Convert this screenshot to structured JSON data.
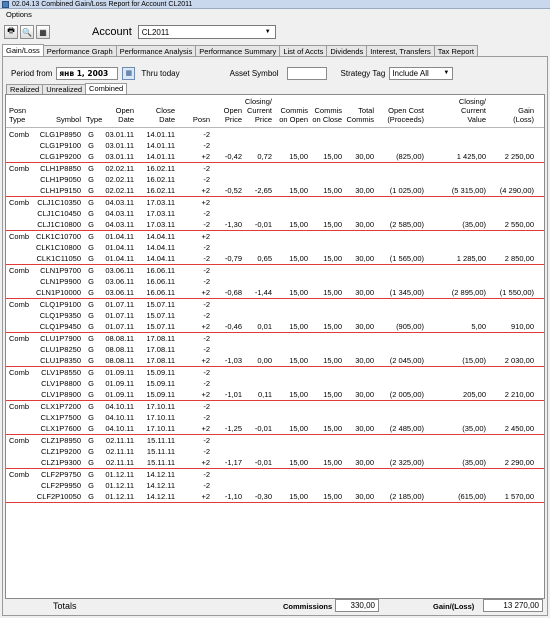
{
  "window": {
    "title": "02.04.13  Combined Gain/Loss Report for Account  CL2011"
  },
  "menu": {
    "options": "Options"
  },
  "toolbar": {
    "icons": [
      "printer-icon",
      "print-preview-icon",
      "export-icon"
    ],
    "account_label": "Account",
    "account_value": "CL2011"
  },
  "main_tabs": [
    "Gain/Loss",
    "Performance Graph",
    "Performance Analysis",
    "Performance Summary",
    "List of Accts",
    "Dividends",
    "Interest, Transfers",
    "Tax Report"
  ],
  "filters": {
    "period_from_label": "Period from",
    "period_from_value": "янв 1, 2003",
    "thru_label": "Thru  today",
    "asset_symbol_label": "Asset Symbol",
    "asset_symbol_value": "",
    "strategy_tag_label": "Strategy Tag",
    "strategy_tag_value": "Include All"
  },
  "sub_tabs": [
    "Realized",
    "Unrealized",
    "Combined"
  ],
  "columns": {
    "posn_type": [
      "Posn",
      "Type"
    ],
    "symbol": [
      "",
      "Symbol"
    ],
    "type": [
      "",
      "Type"
    ],
    "open_date": [
      "Open",
      "Date"
    ],
    "close_date": [
      "Close",
      "Date"
    ],
    "posn": [
      "",
      "Posn"
    ],
    "open_price": [
      "Open",
      "Price"
    ],
    "closing_price": [
      "Closing/",
      "Current",
      "Price"
    ],
    "commis_open": [
      "Commis",
      "on Open"
    ],
    "commis_close": [
      "Commis",
      "on Close"
    ],
    "total_commis": [
      "Total",
      "Commis"
    ],
    "open_cost": [
      "Open Cost",
      "(Proceeds)"
    ],
    "closing_value": [
      "Closing/",
      "Current",
      "Value"
    ],
    "gain": [
      "Gain",
      "(Loss)"
    ]
  },
  "groups": [
    {
      "rows": [
        [
          "Comb",
          "CLG1P8950",
          "G",
          "03.01.11",
          "14.01.11",
          "-2",
          "",
          "",
          "",
          "",
          "",
          "",
          "",
          ""
        ],
        [
          "",
          "CLG1P9100",
          "G",
          "03.01.11",
          "14.01.11",
          "-2",
          "",
          "",
          "",
          "",
          "",
          "",
          "",
          ""
        ],
        [
          "",
          "CLG1P9200",
          "G",
          "03.01.11",
          "14.01.11",
          "+2",
          "-0,42",
          "0,72",
          "15,00",
          "15,00",
          "30,00",
          "(825,00)",
          "1 425,00",
          "2 250,00"
        ]
      ]
    },
    {
      "rows": [
        [
          "Comb",
          "CLH1P8850",
          "G",
          "02.02.11",
          "16.02.11",
          "-2",
          "",
          "",
          "",
          "",
          "",
          "",
          "",
          ""
        ],
        [
          "",
          "CLH1P9050",
          "G",
          "02.02.11",
          "16.02.11",
          "-2",
          "",
          "",
          "",
          "",
          "",
          "",
          "",
          ""
        ],
        [
          "",
          "CLH1P9150",
          "G",
          "02.02.11",
          "16.02.11",
          "+2",
          "-0,52",
          "-2,65",
          "15,00",
          "15,00",
          "30,00",
          "(1 025,00)",
          "(5 315,00)",
          "(4 290,00)"
        ]
      ]
    },
    {
      "rows": [
        [
          "Comb",
          "CLJ1C10350",
          "G",
          "04.03.11",
          "17.03.11",
          "+2",
          "",
          "",
          "",
          "",
          "",
          "",
          "",
          ""
        ],
        [
          "",
          "CLJ1C10450",
          "G",
          "04.03.11",
          "17.03.11",
          "-2",
          "",
          "",
          "",
          "",
          "",
          "",
          "",
          ""
        ],
        [
          "",
          "CLJ1C10800",
          "G",
          "04.03.11",
          "17.03.11",
          "-2",
          "-1,30",
          "-0,01",
          "15,00",
          "15,00",
          "30,00",
          "(2 585,00)",
          "(35,00)",
          "2 550,00"
        ]
      ]
    },
    {
      "rows": [
        [
          "Comb",
          "CLK1C10700",
          "G",
          "01.04.11",
          "14.04.11",
          "+2",
          "",
          "",
          "",
          "",
          "",
          "",
          "",
          ""
        ],
        [
          "",
          "CLK1C10800",
          "G",
          "01.04.11",
          "14.04.11",
          "-2",
          "",
          "",
          "",
          "",
          "",
          "",
          "",
          ""
        ],
        [
          "",
          "CLK1C11050",
          "G",
          "01.04.11",
          "14.04.11",
          "-2",
          "-0,79",
          "0,65",
          "15,00",
          "15,00",
          "30,00",
          "(1 565,00)",
          "1 285,00",
          "2 850,00"
        ]
      ]
    },
    {
      "rows": [
        [
          "Comb",
          "CLN1P9700",
          "G",
          "03.06.11",
          "16.06.11",
          "-2",
          "",
          "",
          "",
          "",
          "",
          "",
          "",
          ""
        ],
        [
          "",
          "CLN1P9900",
          "G",
          "03.06.11",
          "16.06.11",
          "-2",
          "",
          "",
          "",
          "",
          "",
          "",
          "",
          ""
        ],
        [
          "",
          "CLN1P10000",
          "G",
          "03.06.11",
          "16.06.11",
          "+2",
          "-0,68",
          "-1,44",
          "15,00",
          "15,00",
          "30,00",
          "(1 345,00)",
          "(2 895,00)",
          "(1 550,00)"
        ]
      ]
    },
    {
      "rows": [
        [
          "Comb",
          "CLQ1P9100",
          "G",
          "01.07.11",
          "15.07.11",
          "-2",
          "",
          "",
          "",
          "",
          "",
          "",
          "",
          ""
        ],
        [
          "",
          "CLQ1P9350",
          "G",
          "01.07.11",
          "15.07.11",
          "-2",
          "",
          "",
          "",
          "",
          "",
          "",
          "",
          ""
        ],
        [
          "",
          "CLQ1P9450",
          "G",
          "01.07.11",
          "15.07.11",
          "+2",
          "-0,46",
          "0,01",
          "15,00",
          "15,00",
          "30,00",
          "(905,00)",
          "5,00",
          "910,00"
        ]
      ]
    },
    {
      "rows": [
        [
          "Comb",
          "CLU1P7900",
          "G",
          "08.08.11",
          "17.08.11",
          "-2",
          "",
          "",
          "",
          "",
          "",
          "",
          "",
          ""
        ],
        [
          "",
          "CLU1P8250",
          "G",
          "08.08.11",
          "17.08.11",
          "-2",
          "",
          "",
          "",
          "",
          "",
          "",
          "",
          ""
        ],
        [
          "",
          "CLU1P8350",
          "G",
          "08.08.11",
          "17.08.11",
          "+2",
          "-1,03",
          "0,00",
          "15,00",
          "15,00",
          "30,00",
          "(2 045,00)",
          "(15,00)",
          "2 030,00"
        ]
      ]
    },
    {
      "rows": [
        [
          "Comb",
          "CLV1P8550",
          "G",
          "01.09.11",
          "15.09.11",
          "-2",
          "",
          "",
          "",
          "",
          "",
          "",
          "",
          ""
        ],
        [
          "",
          "CLV1P8800",
          "G",
          "01.09.11",
          "15.09.11",
          "-2",
          "",
          "",
          "",
          "",
          "",
          "",
          "",
          ""
        ],
        [
          "",
          "CLV1P8900",
          "G",
          "01.09.11",
          "15.09.11",
          "+2",
          "-1,01",
          "0,11",
          "15,00",
          "15,00",
          "30,00",
          "(2 005,00)",
          "205,00",
          "2 210,00"
        ]
      ]
    },
    {
      "rows": [
        [
          "Comb",
          "CLX1P7200",
          "G",
          "04.10.11",
          "17.10.11",
          "-2",
          "",
          "",
          "",
          "",
          "",
          "",
          "",
          ""
        ],
        [
          "",
          "CLX1P7500",
          "G",
          "04.10.11",
          "17.10.11",
          "-2",
          "",
          "",
          "",
          "",
          "",
          "",
          "",
          ""
        ],
        [
          "",
          "CLX1P7600",
          "G",
          "04.10.11",
          "17.10.11",
          "+2",
          "-1,25",
          "-0,01",
          "15,00",
          "15,00",
          "30,00",
          "(2 485,00)",
          "(35,00)",
          "2 450,00"
        ]
      ]
    },
    {
      "rows": [
        [
          "Comb",
          "CLZ1P8950",
          "G",
          "02.11.11",
          "15.11.11",
          "-2",
          "",
          "",
          "",
          "",
          "",
          "",
          "",
          ""
        ],
        [
          "",
          "CLZ1P9200",
          "G",
          "02.11.11",
          "15.11.11",
          "-2",
          "",
          "",
          "",
          "",
          "",
          "",
          "",
          ""
        ],
        [
          "",
          "CLZ1P9300",
          "G",
          "02.11.11",
          "15.11.11",
          "+2",
          "-1,17",
          "-0,01",
          "15,00",
          "15,00",
          "30,00",
          "(2 325,00)",
          "(35,00)",
          "2 290,00"
        ]
      ]
    },
    {
      "rows": [
        [
          "Comb",
          "CLF2P9750",
          "G",
          "01.12.11",
          "14.12.11",
          "-2",
          "",
          "",
          "",
          "",
          "",
          "",
          "",
          ""
        ],
        [
          "",
          "CLF2P9950",
          "G",
          "01.12.11",
          "14.12.11",
          "-2",
          "",
          "",
          "",
          "",
          "",
          "",
          "",
          ""
        ],
        [
          "",
          "CLF2P10050",
          "G",
          "01.12.11",
          "14.12.11",
          "+2",
          "-1,10",
          "-0,30",
          "15,00",
          "15,00",
          "30,00",
          "(2 185,00)",
          "(615,00)",
          "1 570,00"
        ]
      ]
    }
  ],
  "totals": {
    "label": "Totals",
    "commissions_label": "Commissions",
    "commissions_value": "330,00",
    "gain_label": "Gain/(Loss)",
    "gain_value": "13 270,00"
  }
}
